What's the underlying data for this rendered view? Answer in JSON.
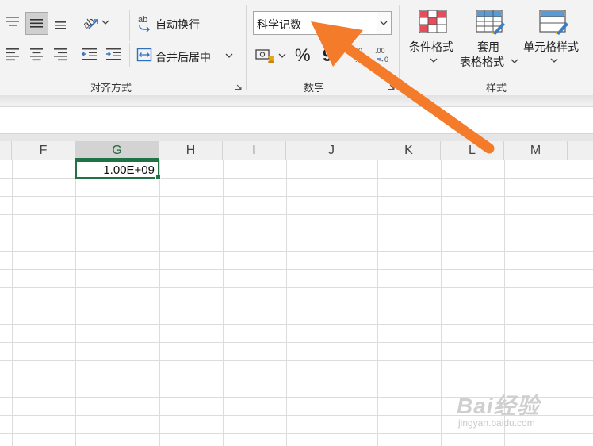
{
  "ribbon": {
    "alignment": {
      "wrap_text_label": "自动换行",
      "merge_center_label": "合并后居中",
      "group_label": "对齐方式"
    },
    "number": {
      "format_value": "科学记数",
      "percent_symbol": "%",
      "comma_symbol": "9",
      "group_label": "数字"
    },
    "styles": {
      "conditional_format_label": "条件格式",
      "table_format_line1": "套用",
      "table_format_line2": "表格格式",
      "cell_styles_label": "单元格样式",
      "group_label": "样式"
    }
  },
  "grid": {
    "columns": [
      "F",
      "G",
      "H",
      "I",
      "J",
      "K",
      "L",
      "M"
    ],
    "active_column": "G",
    "selected_cell_value": "1.00E+09"
  },
  "watermark": {
    "main": "Bai经验",
    "sub": "jingyan.baidu.com"
  },
  "colors": {
    "excel_green": "#217346",
    "annotation_arrow": "#f47b2a"
  }
}
